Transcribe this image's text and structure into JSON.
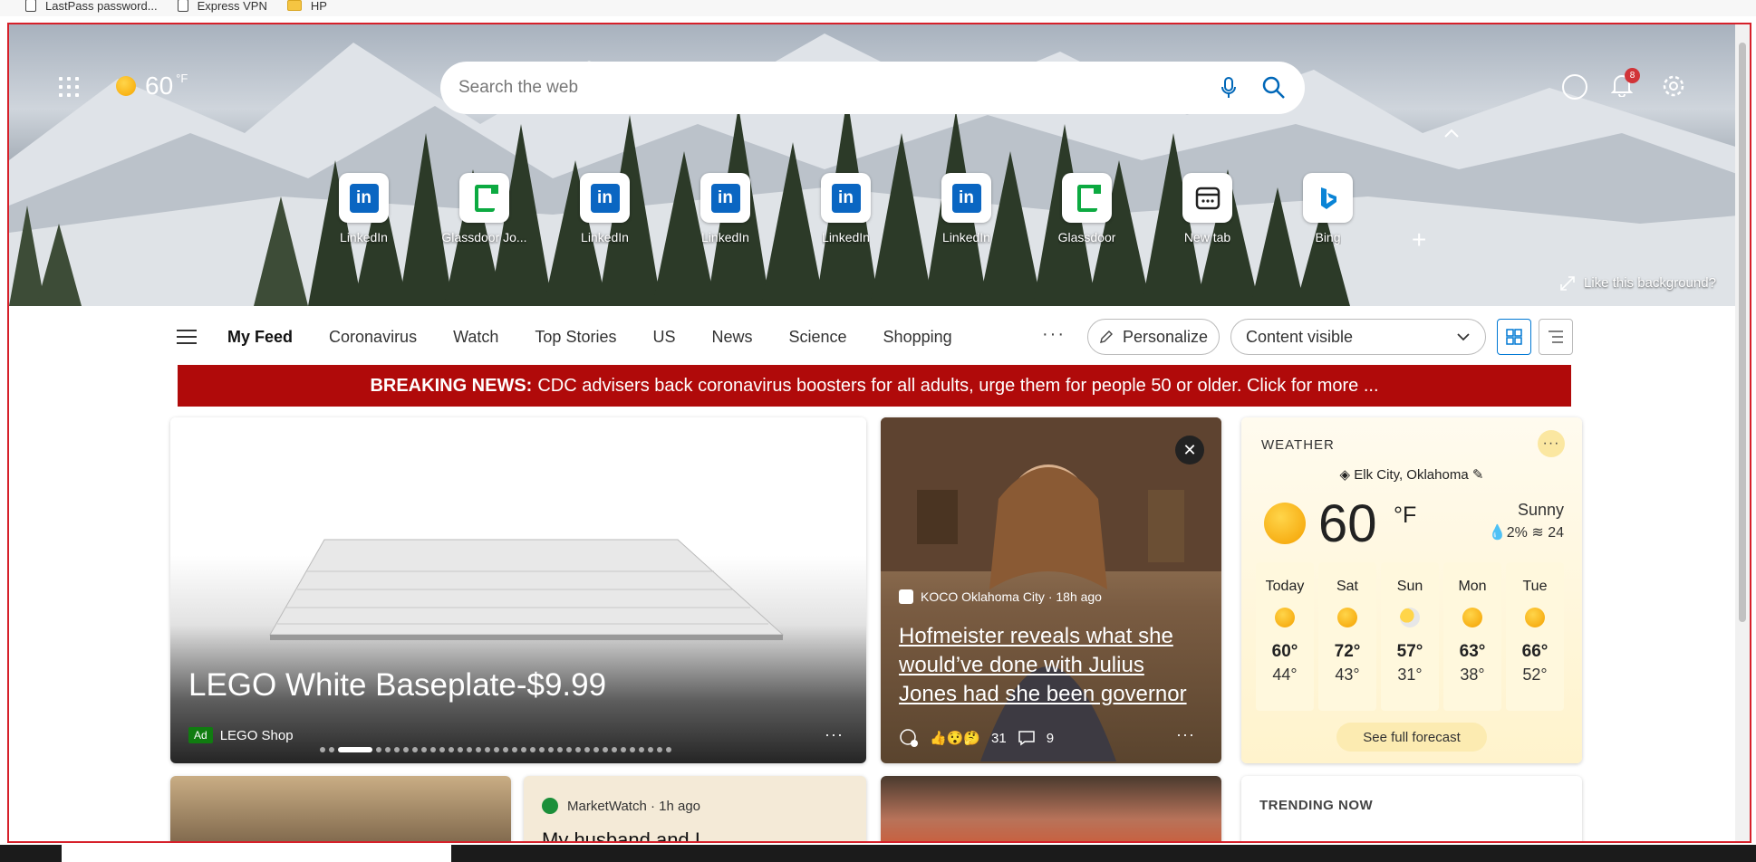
{
  "bookmarks": [
    {
      "label": "LastPass password...",
      "icon": "page-icon"
    },
    {
      "label": "Express VPN",
      "icon": "page-icon"
    },
    {
      "label": "HP",
      "icon": "folder-icon"
    }
  ],
  "header": {
    "temp": "60",
    "unit": "°F",
    "search_placeholder": "Search the web",
    "notifications_count": "8"
  },
  "tiles": [
    {
      "label": "LinkedIn",
      "icon": "linkedin-icon"
    },
    {
      "label": "Glassdoor Jo...",
      "icon": "glassdoor-icon"
    },
    {
      "label": "LinkedIn",
      "icon": "linkedin-icon"
    },
    {
      "label": "LinkedIn",
      "icon": "linkedin-icon"
    },
    {
      "label": "LinkedIn",
      "icon": "linkedin-icon"
    },
    {
      "label": "LinkedIn",
      "icon": "linkedin-icon"
    },
    {
      "label": "Glassdoor",
      "icon": "glassdoor-icon"
    },
    {
      "label": "New tab",
      "icon": "newtab-icon"
    },
    {
      "label": "Bing",
      "icon": "bing-icon"
    }
  ],
  "like_background": "Like this background?",
  "feed": {
    "tabs": [
      "My Feed",
      "Coronavirus",
      "Watch",
      "Top Stories",
      "US",
      "News",
      "Science",
      "Shopping"
    ],
    "more": "···",
    "personalize": "Personalize",
    "content_visible": "Content visible"
  },
  "breaking": {
    "label": "BREAKING NEWS:",
    "text": "CDC advisers back coronavirus boosters for all adults, urge them for people 50 or older. Click for more ..."
  },
  "lego_card": {
    "title": "LEGO White Baseplate-$9.99",
    "ad": "Ad",
    "source": "LEGO Shop",
    "more": "···"
  },
  "news_card": {
    "source": "KOCO Oklahoma City · 18h ago",
    "title": "Hofmeister reveals what she would’ve done with Julius Jones had she been governor",
    "reactions": "31",
    "comments": "9",
    "more": "···",
    "close": "✕"
  },
  "weather_card": {
    "heading": "WEATHER",
    "location": "Elk City, Oklahoma",
    "temp": "60",
    "unit": "°F",
    "condition": "Sunny",
    "precip": "2%",
    "wind": "24",
    "days": [
      {
        "name": "Today",
        "hi": "60°",
        "lo": "44°"
      },
      {
        "name": "Sat",
        "hi": "72°",
        "lo": "43°"
      },
      {
        "name": "Sun",
        "hi": "57°",
        "lo": "31°"
      },
      {
        "name": "Mon",
        "hi": "63°",
        "lo": "38°"
      },
      {
        "name": "Tue",
        "hi": "66°",
        "lo": "52°"
      }
    ],
    "forecast_link": "See full forecast"
  },
  "row2": {
    "marketwatch_source": "MarketWatch · 1h ago",
    "marketwatch_title": "My husband and I",
    "trending": "TRENDING NOW"
  }
}
